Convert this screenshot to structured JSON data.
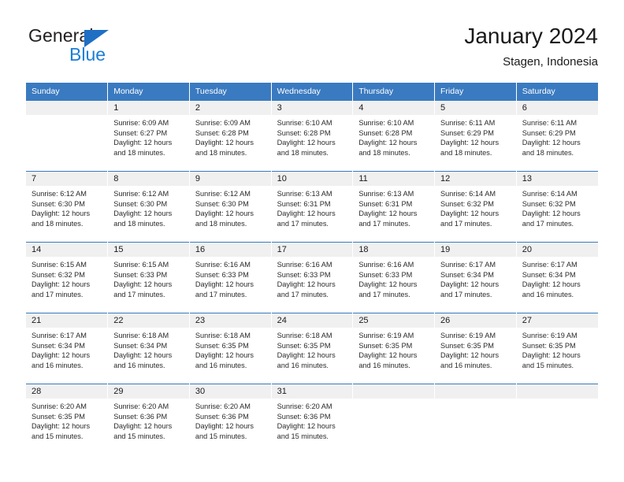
{
  "brand": {
    "name_dark": "General",
    "name_blue": "Blue",
    "triangle_color": "#1f6fc4",
    "blue_text_color": "#1b7ed6"
  },
  "header": {
    "title": "January 2024",
    "subtitle": "Stagen, Indonesia"
  },
  "theme": {
    "header_blue": "#3a7ac0",
    "daynum_band": "#f0f0f0",
    "text": "#1a1a1a"
  },
  "weekdays": [
    "Sunday",
    "Monday",
    "Tuesday",
    "Wednesday",
    "Thursday",
    "Friday",
    "Saturday"
  ],
  "weeks": [
    [
      {
        "day": "",
        "sunrise": "",
        "sunset": "",
        "daylight1": "",
        "daylight2": ""
      },
      {
        "day": "1",
        "sunrise": "Sunrise: 6:09 AM",
        "sunset": "Sunset: 6:27 PM",
        "daylight1": "Daylight: 12 hours",
        "daylight2": "and 18 minutes."
      },
      {
        "day": "2",
        "sunrise": "Sunrise: 6:09 AM",
        "sunset": "Sunset: 6:28 PM",
        "daylight1": "Daylight: 12 hours",
        "daylight2": "and 18 minutes."
      },
      {
        "day": "3",
        "sunrise": "Sunrise: 6:10 AM",
        "sunset": "Sunset: 6:28 PM",
        "daylight1": "Daylight: 12 hours",
        "daylight2": "and 18 minutes."
      },
      {
        "day": "4",
        "sunrise": "Sunrise: 6:10 AM",
        "sunset": "Sunset: 6:28 PM",
        "daylight1": "Daylight: 12 hours",
        "daylight2": "and 18 minutes."
      },
      {
        "day": "5",
        "sunrise": "Sunrise: 6:11 AM",
        "sunset": "Sunset: 6:29 PM",
        "daylight1": "Daylight: 12 hours",
        "daylight2": "and 18 minutes."
      },
      {
        "day": "6",
        "sunrise": "Sunrise: 6:11 AM",
        "sunset": "Sunset: 6:29 PM",
        "daylight1": "Daylight: 12 hours",
        "daylight2": "and 18 minutes."
      }
    ],
    [
      {
        "day": "7",
        "sunrise": "Sunrise: 6:12 AM",
        "sunset": "Sunset: 6:30 PM",
        "daylight1": "Daylight: 12 hours",
        "daylight2": "and 18 minutes."
      },
      {
        "day": "8",
        "sunrise": "Sunrise: 6:12 AM",
        "sunset": "Sunset: 6:30 PM",
        "daylight1": "Daylight: 12 hours",
        "daylight2": "and 18 minutes."
      },
      {
        "day": "9",
        "sunrise": "Sunrise: 6:12 AM",
        "sunset": "Sunset: 6:30 PM",
        "daylight1": "Daylight: 12 hours",
        "daylight2": "and 18 minutes."
      },
      {
        "day": "10",
        "sunrise": "Sunrise: 6:13 AM",
        "sunset": "Sunset: 6:31 PM",
        "daylight1": "Daylight: 12 hours",
        "daylight2": "and 17 minutes."
      },
      {
        "day": "11",
        "sunrise": "Sunrise: 6:13 AM",
        "sunset": "Sunset: 6:31 PM",
        "daylight1": "Daylight: 12 hours",
        "daylight2": "and 17 minutes."
      },
      {
        "day": "12",
        "sunrise": "Sunrise: 6:14 AM",
        "sunset": "Sunset: 6:32 PM",
        "daylight1": "Daylight: 12 hours",
        "daylight2": "and 17 minutes."
      },
      {
        "day": "13",
        "sunrise": "Sunrise: 6:14 AM",
        "sunset": "Sunset: 6:32 PM",
        "daylight1": "Daylight: 12 hours",
        "daylight2": "and 17 minutes."
      }
    ],
    [
      {
        "day": "14",
        "sunrise": "Sunrise: 6:15 AM",
        "sunset": "Sunset: 6:32 PM",
        "daylight1": "Daylight: 12 hours",
        "daylight2": "and 17 minutes."
      },
      {
        "day": "15",
        "sunrise": "Sunrise: 6:15 AM",
        "sunset": "Sunset: 6:33 PM",
        "daylight1": "Daylight: 12 hours",
        "daylight2": "and 17 minutes."
      },
      {
        "day": "16",
        "sunrise": "Sunrise: 6:16 AM",
        "sunset": "Sunset: 6:33 PM",
        "daylight1": "Daylight: 12 hours",
        "daylight2": "and 17 minutes."
      },
      {
        "day": "17",
        "sunrise": "Sunrise: 6:16 AM",
        "sunset": "Sunset: 6:33 PM",
        "daylight1": "Daylight: 12 hours",
        "daylight2": "and 17 minutes."
      },
      {
        "day": "18",
        "sunrise": "Sunrise: 6:16 AM",
        "sunset": "Sunset: 6:33 PM",
        "daylight1": "Daylight: 12 hours",
        "daylight2": "and 17 minutes."
      },
      {
        "day": "19",
        "sunrise": "Sunrise: 6:17 AM",
        "sunset": "Sunset: 6:34 PM",
        "daylight1": "Daylight: 12 hours",
        "daylight2": "and 17 minutes."
      },
      {
        "day": "20",
        "sunrise": "Sunrise: 6:17 AM",
        "sunset": "Sunset: 6:34 PM",
        "daylight1": "Daylight: 12 hours",
        "daylight2": "and 16 minutes."
      }
    ],
    [
      {
        "day": "21",
        "sunrise": "Sunrise: 6:17 AM",
        "sunset": "Sunset: 6:34 PM",
        "daylight1": "Daylight: 12 hours",
        "daylight2": "and 16 minutes."
      },
      {
        "day": "22",
        "sunrise": "Sunrise: 6:18 AM",
        "sunset": "Sunset: 6:34 PM",
        "daylight1": "Daylight: 12 hours",
        "daylight2": "and 16 minutes."
      },
      {
        "day": "23",
        "sunrise": "Sunrise: 6:18 AM",
        "sunset": "Sunset: 6:35 PM",
        "daylight1": "Daylight: 12 hours",
        "daylight2": "and 16 minutes."
      },
      {
        "day": "24",
        "sunrise": "Sunrise: 6:18 AM",
        "sunset": "Sunset: 6:35 PM",
        "daylight1": "Daylight: 12 hours",
        "daylight2": "and 16 minutes."
      },
      {
        "day": "25",
        "sunrise": "Sunrise: 6:19 AM",
        "sunset": "Sunset: 6:35 PM",
        "daylight1": "Daylight: 12 hours",
        "daylight2": "and 16 minutes."
      },
      {
        "day": "26",
        "sunrise": "Sunrise: 6:19 AM",
        "sunset": "Sunset: 6:35 PM",
        "daylight1": "Daylight: 12 hours",
        "daylight2": "and 16 minutes."
      },
      {
        "day": "27",
        "sunrise": "Sunrise: 6:19 AM",
        "sunset": "Sunset: 6:35 PM",
        "daylight1": "Daylight: 12 hours",
        "daylight2": "and 15 minutes."
      }
    ],
    [
      {
        "day": "28",
        "sunrise": "Sunrise: 6:20 AM",
        "sunset": "Sunset: 6:35 PM",
        "daylight1": "Daylight: 12 hours",
        "daylight2": "and 15 minutes."
      },
      {
        "day": "29",
        "sunrise": "Sunrise: 6:20 AM",
        "sunset": "Sunset: 6:36 PM",
        "daylight1": "Daylight: 12 hours",
        "daylight2": "and 15 minutes."
      },
      {
        "day": "30",
        "sunrise": "Sunrise: 6:20 AM",
        "sunset": "Sunset: 6:36 PM",
        "daylight1": "Daylight: 12 hours",
        "daylight2": "and 15 minutes."
      },
      {
        "day": "31",
        "sunrise": "Sunrise: 6:20 AM",
        "sunset": "Sunset: 6:36 PM",
        "daylight1": "Daylight: 12 hours",
        "daylight2": "and 15 minutes."
      },
      {
        "day": "",
        "sunrise": "",
        "sunset": "",
        "daylight1": "",
        "daylight2": ""
      },
      {
        "day": "",
        "sunrise": "",
        "sunset": "",
        "daylight1": "",
        "daylight2": ""
      },
      {
        "day": "",
        "sunrise": "",
        "sunset": "",
        "daylight1": "",
        "daylight2": ""
      }
    ]
  ]
}
